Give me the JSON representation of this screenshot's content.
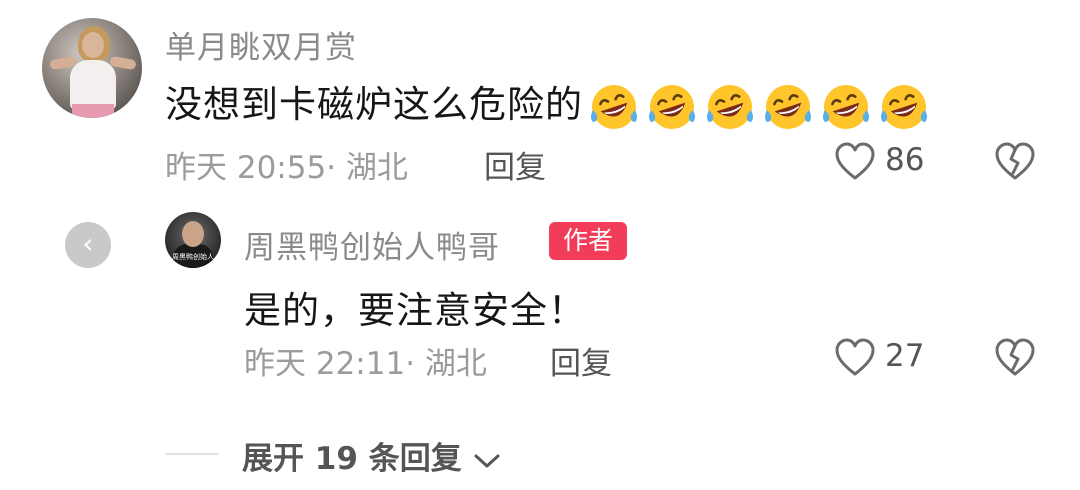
{
  "comment": {
    "username": "单月眺双月赏",
    "text": "没想到卡磁炉这么危险的",
    "emojis": [
      "laugh-cry-emoji",
      "laugh-cry-emoji",
      "laugh-cry-emoji",
      "laugh-cry-emoji",
      "laugh-cry-emoji",
      "laugh-cry-emoji"
    ],
    "time_location": "昨天 20:55· 湖北",
    "reply_label": "回复",
    "like_count": "86"
  },
  "reply": {
    "username": "周黑鸭创始人鸭哥",
    "badge": "作者",
    "avatar_caption": "周黑鸭创始人",
    "text": "是的，要注意安全！",
    "time_location": "昨天 22:11· 湖北",
    "reply_label": "回复",
    "like_count": "27"
  },
  "expand": {
    "label": "展开 19 条回复"
  },
  "colors": {
    "author_badge": "#f23d5a",
    "emoji_face": "#ffc52b",
    "tear": "#5aaeea"
  }
}
